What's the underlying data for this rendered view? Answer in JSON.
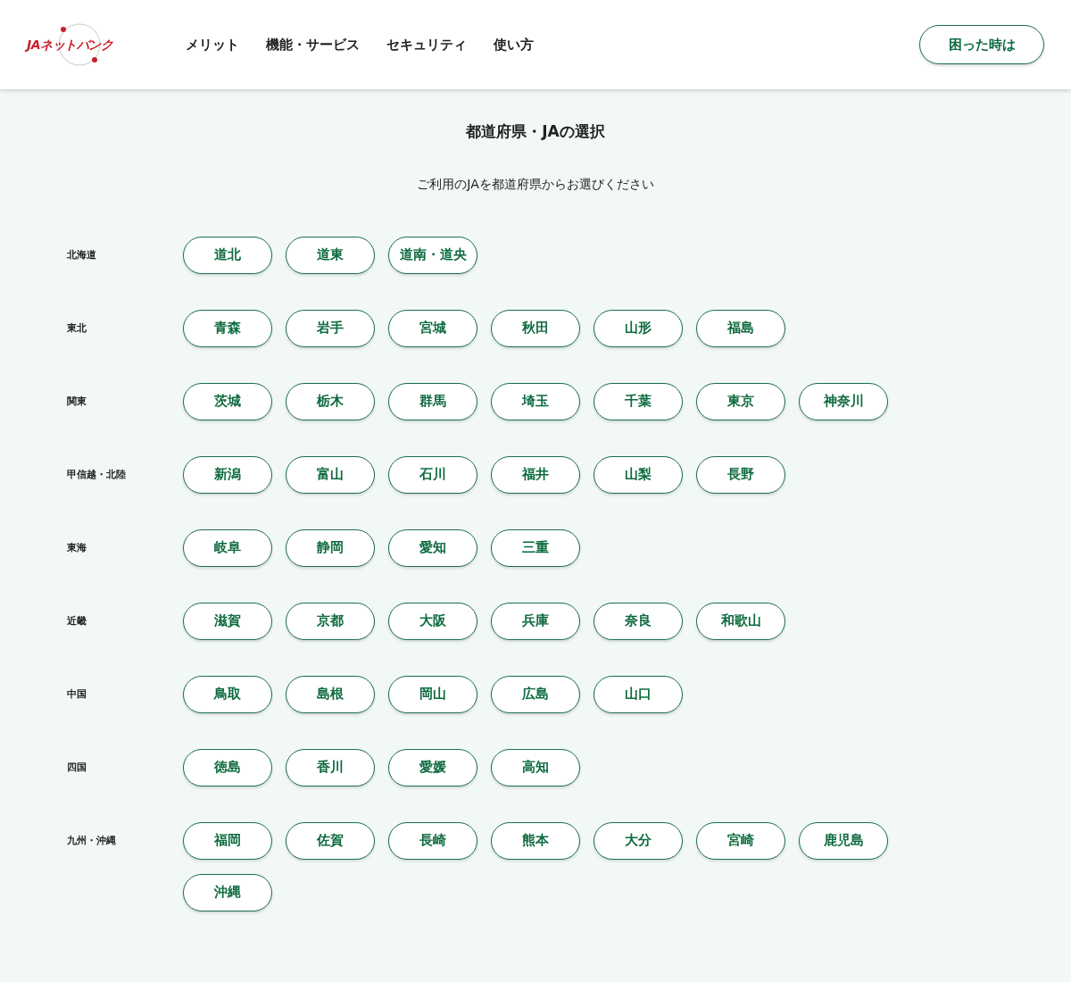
{
  "header": {
    "logo": "JAネットバンク",
    "nav": [
      "メリット",
      "機能・サービス",
      "セキュリティ",
      "使い方"
    ],
    "help_button": "困った時は"
  },
  "title": "都道府県・JAの選択",
  "subtitle": "ご利用のJAを都道府県からお選びください",
  "regions": [
    {
      "name": "北海道",
      "areas": [
        "道北",
        "道東",
        "道南・道央"
      ]
    },
    {
      "name": "東北",
      "areas": [
        "青森",
        "岩手",
        "宮城",
        "秋田",
        "山形",
        "福島"
      ]
    },
    {
      "name": "関東",
      "areas": [
        "茨城",
        "栃木",
        "群馬",
        "埼玉",
        "千葉",
        "東京",
        "神奈川"
      ]
    },
    {
      "name": "甲信越・北陸",
      "areas": [
        "新潟",
        "富山",
        "石川",
        "福井",
        "山梨",
        "長野"
      ]
    },
    {
      "name": "東海",
      "areas": [
        "岐阜",
        "静岡",
        "愛知",
        "三重"
      ]
    },
    {
      "name": "近畿",
      "areas": [
        "滋賀",
        "京都",
        "大阪",
        "兵庫",
        "奈良",
        "和歌山"
      ]
    },
    {
      "name": "中国",
      "areas": [
        "鳥取",
        "島根",
        "岡山",
        "広島",
        "山口"
      ]
    },
    {
      "name": "四国",
      "areas": [
        "徳島",
        "香川",
        "愛媛",
        "高知"
      ]
    },
    {
      "name": "九州・沖縄",
      "areas": [
        "福岡",
        "佐賀",
        "長崎",
        "熊本",
        "大分",
        "宮崎",
        "鹿児島",
        "沖縄"
      ]
    }
  ]
}
